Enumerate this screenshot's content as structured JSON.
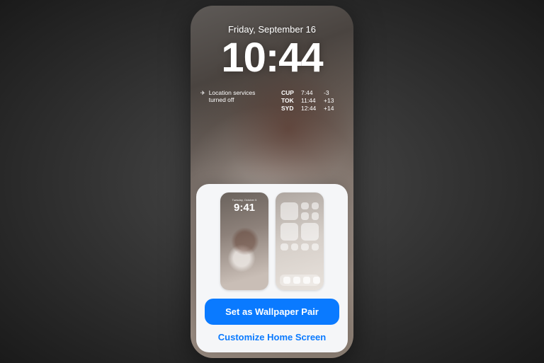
{
  "lockscreen": {
    "date": "Friday, September 16",
    "time": "10:44",
    "location_widget": {
      "icon": "✈",
      "text": "Location services turned off"
    },
    "world_clock": [
      {
        "city": "CUP",
        "time": "7:44",
        "offset": "-3"
      },
      {
        "city": "TOK",
        "time": "11:44",
        "offset": "+13"
      },
      {
        "city": "SYD",
        "time": "12:44",
        "offset": "+14"
      }
    ]
  },
  "sheet": {
    "preview_lock": {
      "date": "Tuesday, October 5",
      "time": "9:41"
    },
    "set_pair_label": "Set as Wallpaper Pair",
    "customize_label": "Customize Home Screen"
  },
  "colors": {
    "accent": "#0a7aff"
  }
}
